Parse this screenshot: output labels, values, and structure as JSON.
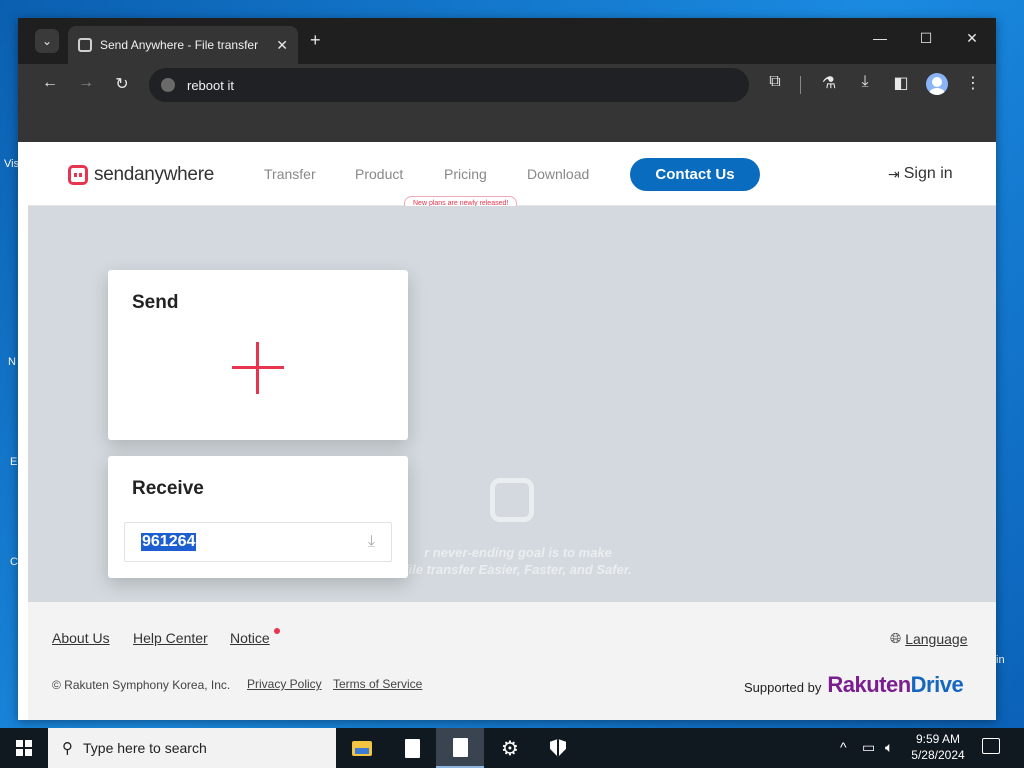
{
  "browser": {
    "tab_title": "Send Anywhere - File transfer",
    "address": "reboot it",
    "new_tab_label": "+",
    "close_tab_label": "✕"
  },
  "site": {
    "logo_text": "sendanywhere",
    "nav": [
      "Transfer",
      "Product",
      "Pricing",
      "Download"
    ],
    "pricing_badge": "New plans are newly released!",
    "contact_label": "Contact Us",
    "signin_label": "Sign in"
  },
  "send_card": {
    "title": "Send"
  },
  "receive_card": {
    "title": "Receive",
    "key_value": "961264"
  },
  "hero_text": {
    "line1": "r never-ending goal is to make",
    "line2": "file transfer Easier, Faster, and Safer."
  },
  "footer": {
    "links": [
      "About Us",
      "Help Center",
      "Notice"
    ],
    "language": "Language",
    "copyright": "© Rakuten Symphony Korea, Inc.",
    "privacy": "Privacy Policy",
    "terms": "Terms of Service",
    "supported_by": "Supported by",
    "brand_1": "Rakuten",
    "brand_2": "Drive"
  },
  "desktop_fragments": [
    "Vis",
    "N",
    "E",
    "C",
    "in"
  ],
  "taskbar": {
    "search_placeholder": "Type here to search",
    "time": "9:59 AM",
    "date": "5/28/2024"
  },
  "colors": {
    "accent_red": "#e8344e",
    "contact_blue": "#0a6cbf",
    "rakuten_purple": "#7a1f8f",
    "drive_blue": "#1566c0"
  }
}
